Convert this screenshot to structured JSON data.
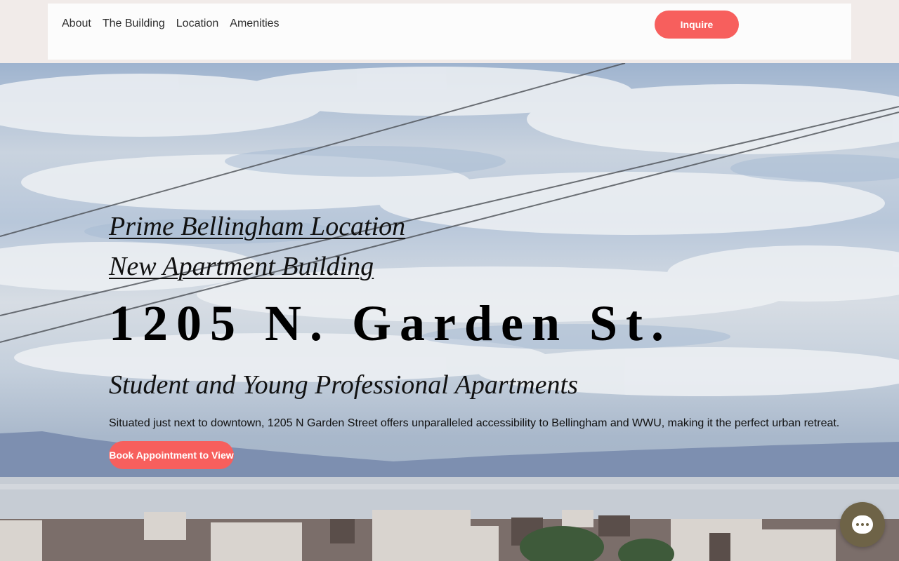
{
  "nav": {
    "items": [
      {
        "label": "About"
      },
      {
        "label": "The Building"
      },
      {
        "label": "Location"
      },
      {
        "label": "Amenities"
      }
    ],
    "inquire_label": "Inquire"
  },
  "hero": {
    "subline_1": "Prime Bellingham Location",
    "subline_2": "New Apartment Building",
    "address": "1205 N. Garden St.",
    "tagline": "Student and Young Professional Apartments",
    "description": "Situated just next to downtown, 1205 N Garden Street offers unparalleled accessibility to Bellingham and WWU, making it the perfect urban retreat.",
    "cta_label": "Book Appointment to View"
  },
  "chat": {
    "icon": "chat-bubble-icon"
  },
  "colors": {
    "accent": "#f75f5d",
    "chat_bg": "#6e6347",
    "header_bg": "#fcfcfc",
    "strip_bg": "#f1ebe9"
  }
}
